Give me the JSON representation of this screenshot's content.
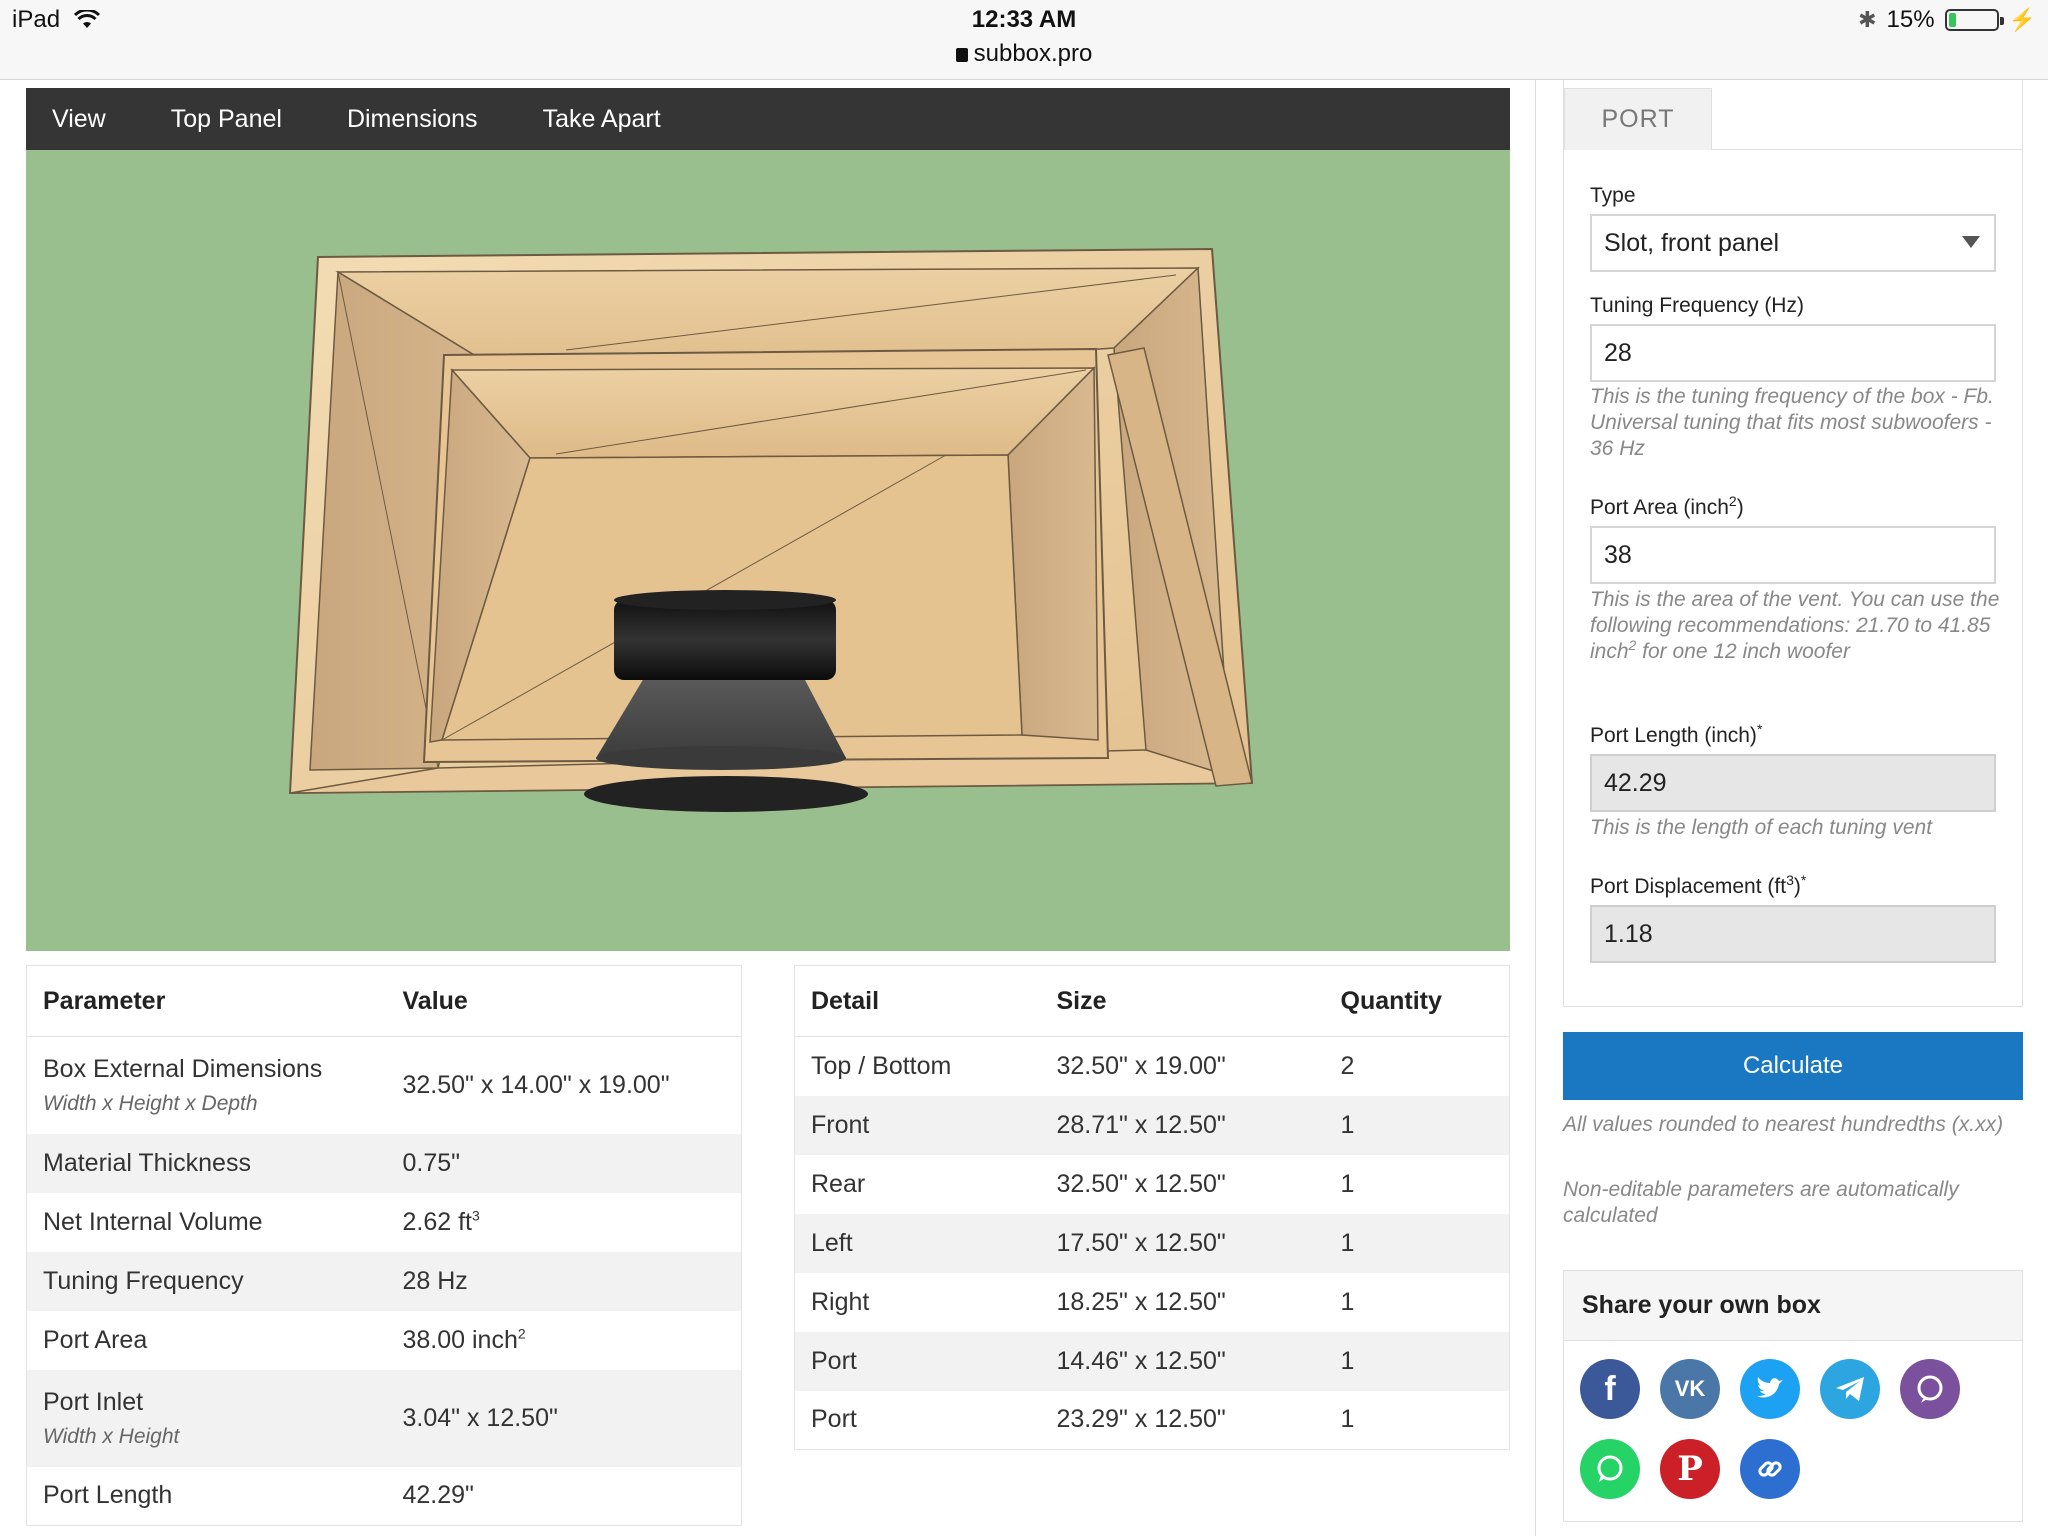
{
  "status_bar": {
    "device": "iPad",
    "time": "12:33 AM",
    "url": "subbox.pro",
    "battery": "15%",
    "battery_level": 0.15
  },
  "nav": {
    "items": [
      "View",
      "Top Panel",
      "Dimensions",
      "Take Apart"
    ]
  },
  "param_table": {
    "headers": [
      "Parameter",
      "Value"
    ],
    "rows": [
      {
        "name": "Box External Dimensions",
        "sub": "Width x Height x Depth",
        "value": "32.50\" x 14.00\" x 19.00\""
      },
      {
        "name": "Material Thickness",
        "sub": "",
        "value": "0.75\""
      },
      {
        "name": "Net Internal Volume",
        "sub": "",
        "value": "2.62 ft",
        "sup": "3"
      },
      {
        "name": "Tuning Frequency",
        "sub": "",
        "value": "28 Hz"
      },
      {
        "name": "Port Area",
        "sub": "",
        "value": "38.00 inch",
        "sup": "2"
      },
      {
        "name": "Port Inlet",
        "sub": "Width x Height",
        "value": "3.04\" x 12.50\""
      },
      {
        "name": "Port Length",
        "sub": "",
        "value": "42.29\""
      }
    ]
  },
  "detail_table": {
    "headers": [
      "Detail",
      "Size",
      "Quantity"
    ],
    "rows": [
      {
        "detail": "Top / Bottom",
        "size": "32.50\" x 19.00\"",
        "qty": "2"
      },
      {
        "detail": "Front",
        "size": "28.71\" x 12.50\"",
        "qty": "1"
      },
      {
        "detail": "Rear",
        "size": "32.50\" x 12.50\"",
        "qty": "1"
      },
      {
        "detail": "Left",
        "size": "17.50\" x 12.50\"",
        "qty": "1"
      },
      {
        "detail": "Right",
        "size": "18.25\" x 12.50\"",
        "qty": "1"
      },
      {
        "detail": "Port",
        "size": "14.46\" x 12.50\"",
        "qty": "1"
      },
      {
        "detail": "Port",
        "size": "23.29\" x 12.50\"",
        "qty": "1"
      }
    ]
  },
  "port_panel": {
    "tab": "PORT",
    "type_label": "Type",
    "type_value": "Slot, front panel",
    "tuning_label": "Tuning Frequency (Hz)",
    "tuning_value": "28",
    "tuning_help": "This is the tuning frequency of the box - Fb. Universal tuning that fits most subwoofers - 36 Hz",
    "area_label": "Port Area (inch",
    "area_label_sup": "2",
    "area_label_end": ")",
    "area_value": "38",
    "area_help": "This is the area of the vent. You can use the following recommendations: 21.70 to 41.85 inch",
    "area_help_sup": "2",
    "area_help_end": " for one 12 inch woofer",
    "length_label": "Port Length (inch)",
    "length_label_sup": "*",
    "length_value": "42.29",
    "length_help": "This is the length of each tuning vent",
    "disp_label": "Port Displacement (ft",
    "disp_label_sup": "3",
    "disp_label_end": ")",
    "disp_label_sup2": "*",
    "disp_value": "1.18"
  },
  "calculate_label": "Calculate",
  "notes": [
    "All values rounded to nearest hundredths (x.xx)",
    "Non-editable parameters are automatically calculated"
  ],
  "share": {
    "title": "Share your own box",
    "buttons": [
      {
        "name": "facebook",
        "color": "#3b5998"
      },
      {
        "name": "vk",
        "color": "#4a76a8"
      },
      {
        "name": "twitter",
        "color": "#1da1f2"
      },
      {
        "name": "telegram",
        "color": "#2ca5e0"
      },
      {
        "name": "viber",
        "color": "#7b519d"
      },
      {
        "name": "whatsapp",
        "color": "#25d366"
      },
      {
        "name": "pinterest",
        "color": "#cb2027"
      },
      {
        "name": "copy-link",
        "color": "#2c6fd1"
      }
    ]
  },
  "colors": {
    "viewer_bg": "#9abf8f",
    "navbar_bg": "#353535",
    "accent": "#1a78c2",
    "wood": "#e9c99b"
  }
}
